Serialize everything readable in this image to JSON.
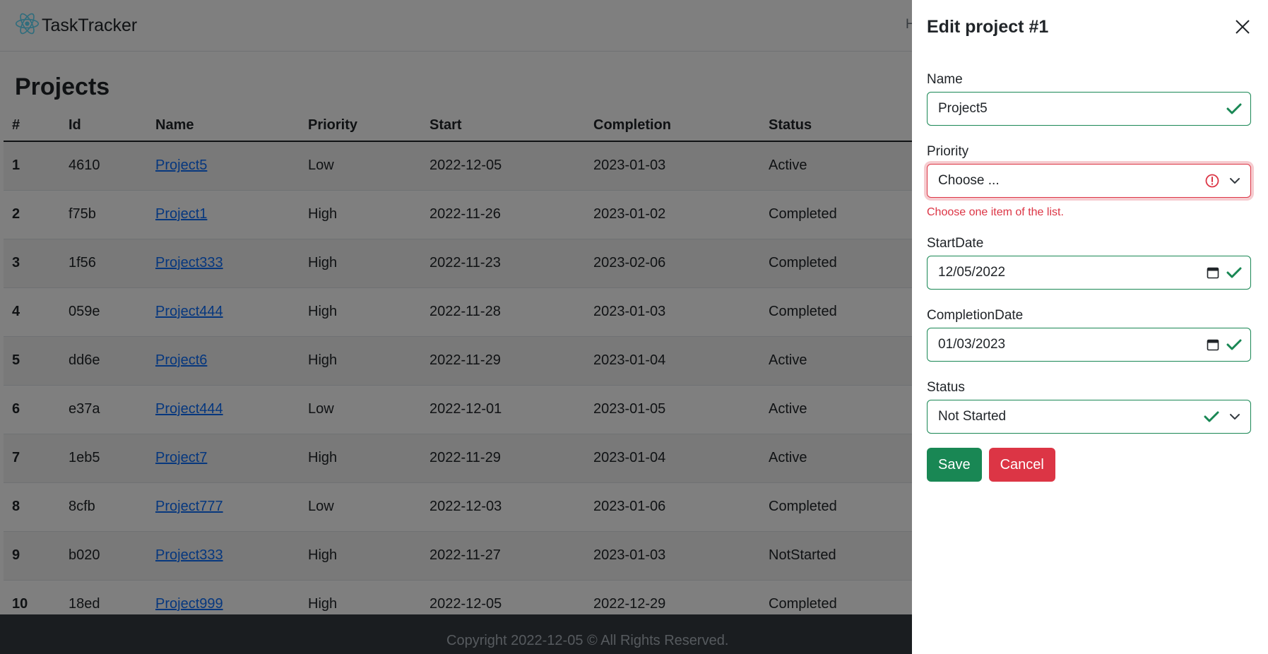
{
  "app": {
    "brand": "TaskTracker",
    "nav_partial": "H"
  },
  "page": {
    "title": "Projects"
  },
  "table": {
    "headers": [
      "#",
      "Id",
      "Name",
      "Priority",
      "Start",
      "Completion",
      "Status"
    ],
    "rows": [
      [
        "1",
        "4610",
        "Project5",
        "Low",
        "2022-12-05",
        "2023-01-03",
        "Active"
      ],
      [
        "2",
        "f75b",
        "Project1",
        "High",
        "2022-11-26",
        "2023-01-02",
        "Completed"
      ],
      [
        "3",
        "1f56",
        "Project333",
        "High",
        "2022-11-23",
        "2023-02-06",
        "Completed"
      ],
      [
        "4",
        "059e",
        "Project444",
        "High",
        "2022-11-28",
        "2023-01-03",
        "Completed"
      ],
      [
        "5",
        "dd6e",
        "Project6",
        "High",
        "2022-11-29",
        "2023-01-04",
        "Active"
      ],
      [
        "6",
        "e37a",
        "Project444",
        "Low",
        "2022-12-01",
        "2023-01-05",
        "Active"
      ],
      [
        "7",
        "1eb5",
        "Project7",
        "High",
        "2022-11-29",
        "2023-01-04",
        "Active"
      ],
      [
        "8",
        "8cfb",
        "Project777",
        "Low",
        "2022-12-03",
        "2023-01-06",
        "Completed"
      ],
      [
        "9",
        "b020",
        "Project333",
        "High",
        "2022-11-27",
        "2023-01-03",
        "NotStarted"
      ],
      [
        "10",
        "18ed",
        "Project999",
        "High",
        "2022-12-05",
        "2022-12-29",
        "Completed"
      ]
    ]
  },
  "footer": {
    "text": "Copyright 2022-12-05 © All Rights Reserved."
  },
  "edit": {
    "title": "Edit project #1",
    "name_label": "Name",
    "name_value": "Project5",
    "priority_label": "Priority",
    "priority_value": "Choose ...",
    "priority_error": "Choose one item of the list.",
    "start_label": "StartDate",
    "start_value": "12/05/2022",
    "completion_label": "CompletionDate",
    "completion_value": "01/03/2023",
    "status_label": "Status",
    "status_value": "Not Started",
    "save_label": "Save",
    "cancel_label": "Cancel"
  },
  "colors": {
    "valid": "#198754",
    "invalid": "#dc3545",
    "link": "#0d6efd",
    "footer_bg": "#343a40"
  }
}
